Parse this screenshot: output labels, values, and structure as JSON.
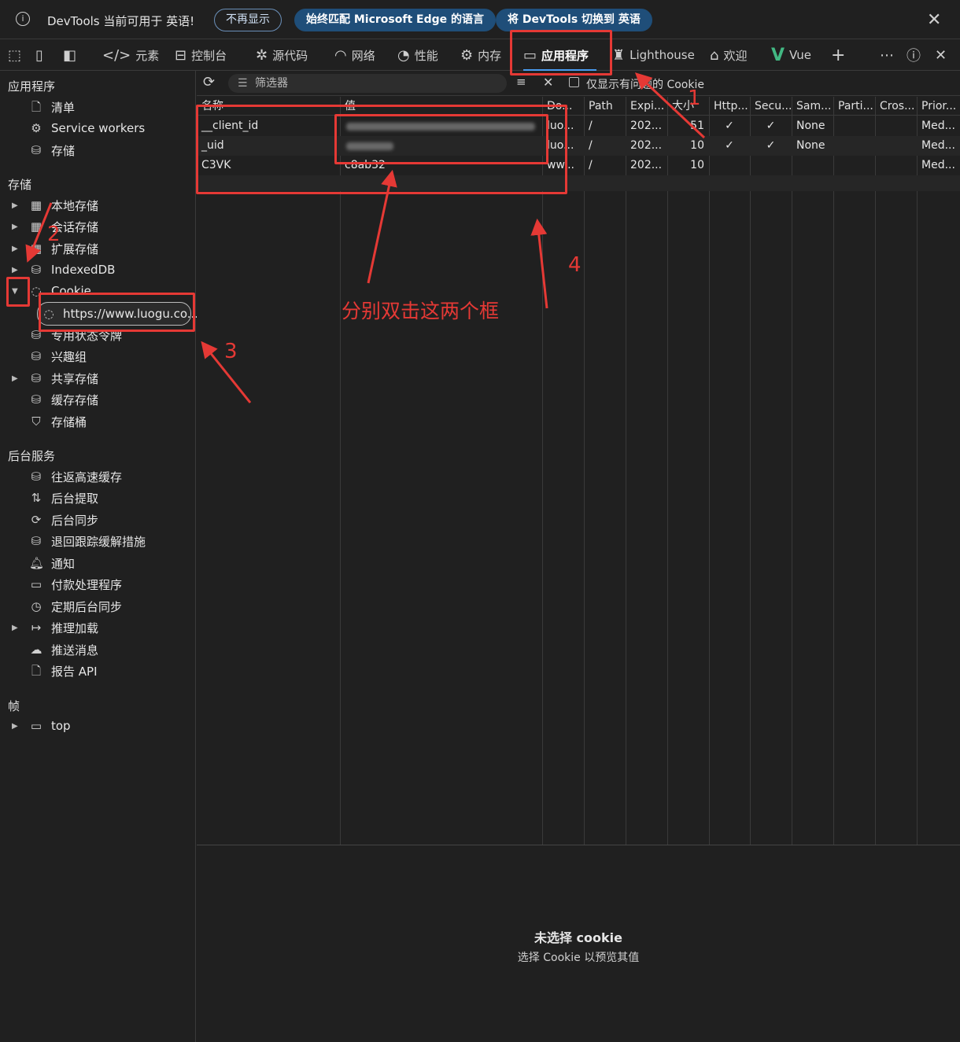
{
  "infobar": {
    "message": "DevTools 当前可用于 英语!",
    "btn_dismiss": "不再显示",
    "btn_match": "始终匹配 Microsoft Edge 的语言",
    "btn_switch": "将 DevTools 切换到 英语"
  },
  "toolbar": {
    "tabs": [
      {
        "label": "元素",
        "icon": "code-icon"
      },
      {
        "label": "控制台",
        "icon": "console-icon"
      },
      {
        "label": "源代码",
        "icon": "bug-icon"
      },
      {
        "label": "网络",
        "icon": "wifi-icon"
      },
      {
        "label": "性能",
        "icon": "gauge-icon"
      },
      {
        "label": "内存",
        "icon": "chip-icon"
      },
      {
        "label": "应用程序",
        "icon": "app-icon",
        "active": true
      },
      {
        "label": "Lighthouse",
        "icon": "lighthouse-icon"
      },
      {
        "label": "欢迎",
        "icon": "home-icon"
      },
      {
        "label": "Vue",
        "icon": "vue-icon"
      }
    ]
  },
  "sidebar": {
    "app_header": "应用程序",
    "app_items": [
      "清单",
      "Service workers",
      "存储"
    ],
    "storage_header": "存储",
    "storage_items": [
      "本地存储",
      "会话存储",
      "扩展存储",
      "IndexedDB",
      "Cookie",
      "https://www.luogu.co...",
      "专用状态令牌",
      "兴趣组",
      "共享存储",
      "缓存存储",
      "存储桶"
    ],
    "bg_header": "后台服务",
    "bg_items": [
      "往返高速缓存",
      "后台提取",
      "后台同步",
      "退回跟踪缓解措施",
      "通知",
      "付款处理程序",
      "定期后台同步",
      "推理加载",
      "推送消息",
      "报告 API"
    ],
    "frames_header": "帧",
    "frames_items": [
      "top"
    ]
  },
  "filter": {
    "placeholder": "筛选器",
    "only_issues_label": "仅显示有问题的 Cookie"
  },
  "table": {
    "headers": [
      "名称",
      "值",
      "Do...",
      "Path",
      "Expi...",
      "大小",
      "Http...",
      "Secu...",
      "Sam...",
      "Parti...",
      "Cros...",
      "Prior..."
    ],
    "rows": [
      [
        "__client_id",
        "",
        "luo...",
        "/",
        "202...",
        "51",
        "✓",
        "✓",
        "None",
        "",
        "",
        "Med..."
      ],
      [
        "_uid",
        "",
        "luo...",
        "/",
        "202...",
        "10",
        "✓",
        "✓",
        "None",
        "",
        "",
        "Med..."
      ],
      [
        "C3VK",
        "c8ab32",
        "ww...",
        "/",
        "202...",
        "10",
        "",
        "",
        "",
        "",
        "",
        "Med..."
      ]
    ]
  },
  "empty_state": {
    "title": "未选择 cookie",
    "subtitle": "选择 Cookie 以预览其值"
  },
  "annotations": {
    "note": "分别双击这两个框",
    "n1": "1",
    "n2": "2",
    "n3": "3",
    "n4": "4"
  }
}
